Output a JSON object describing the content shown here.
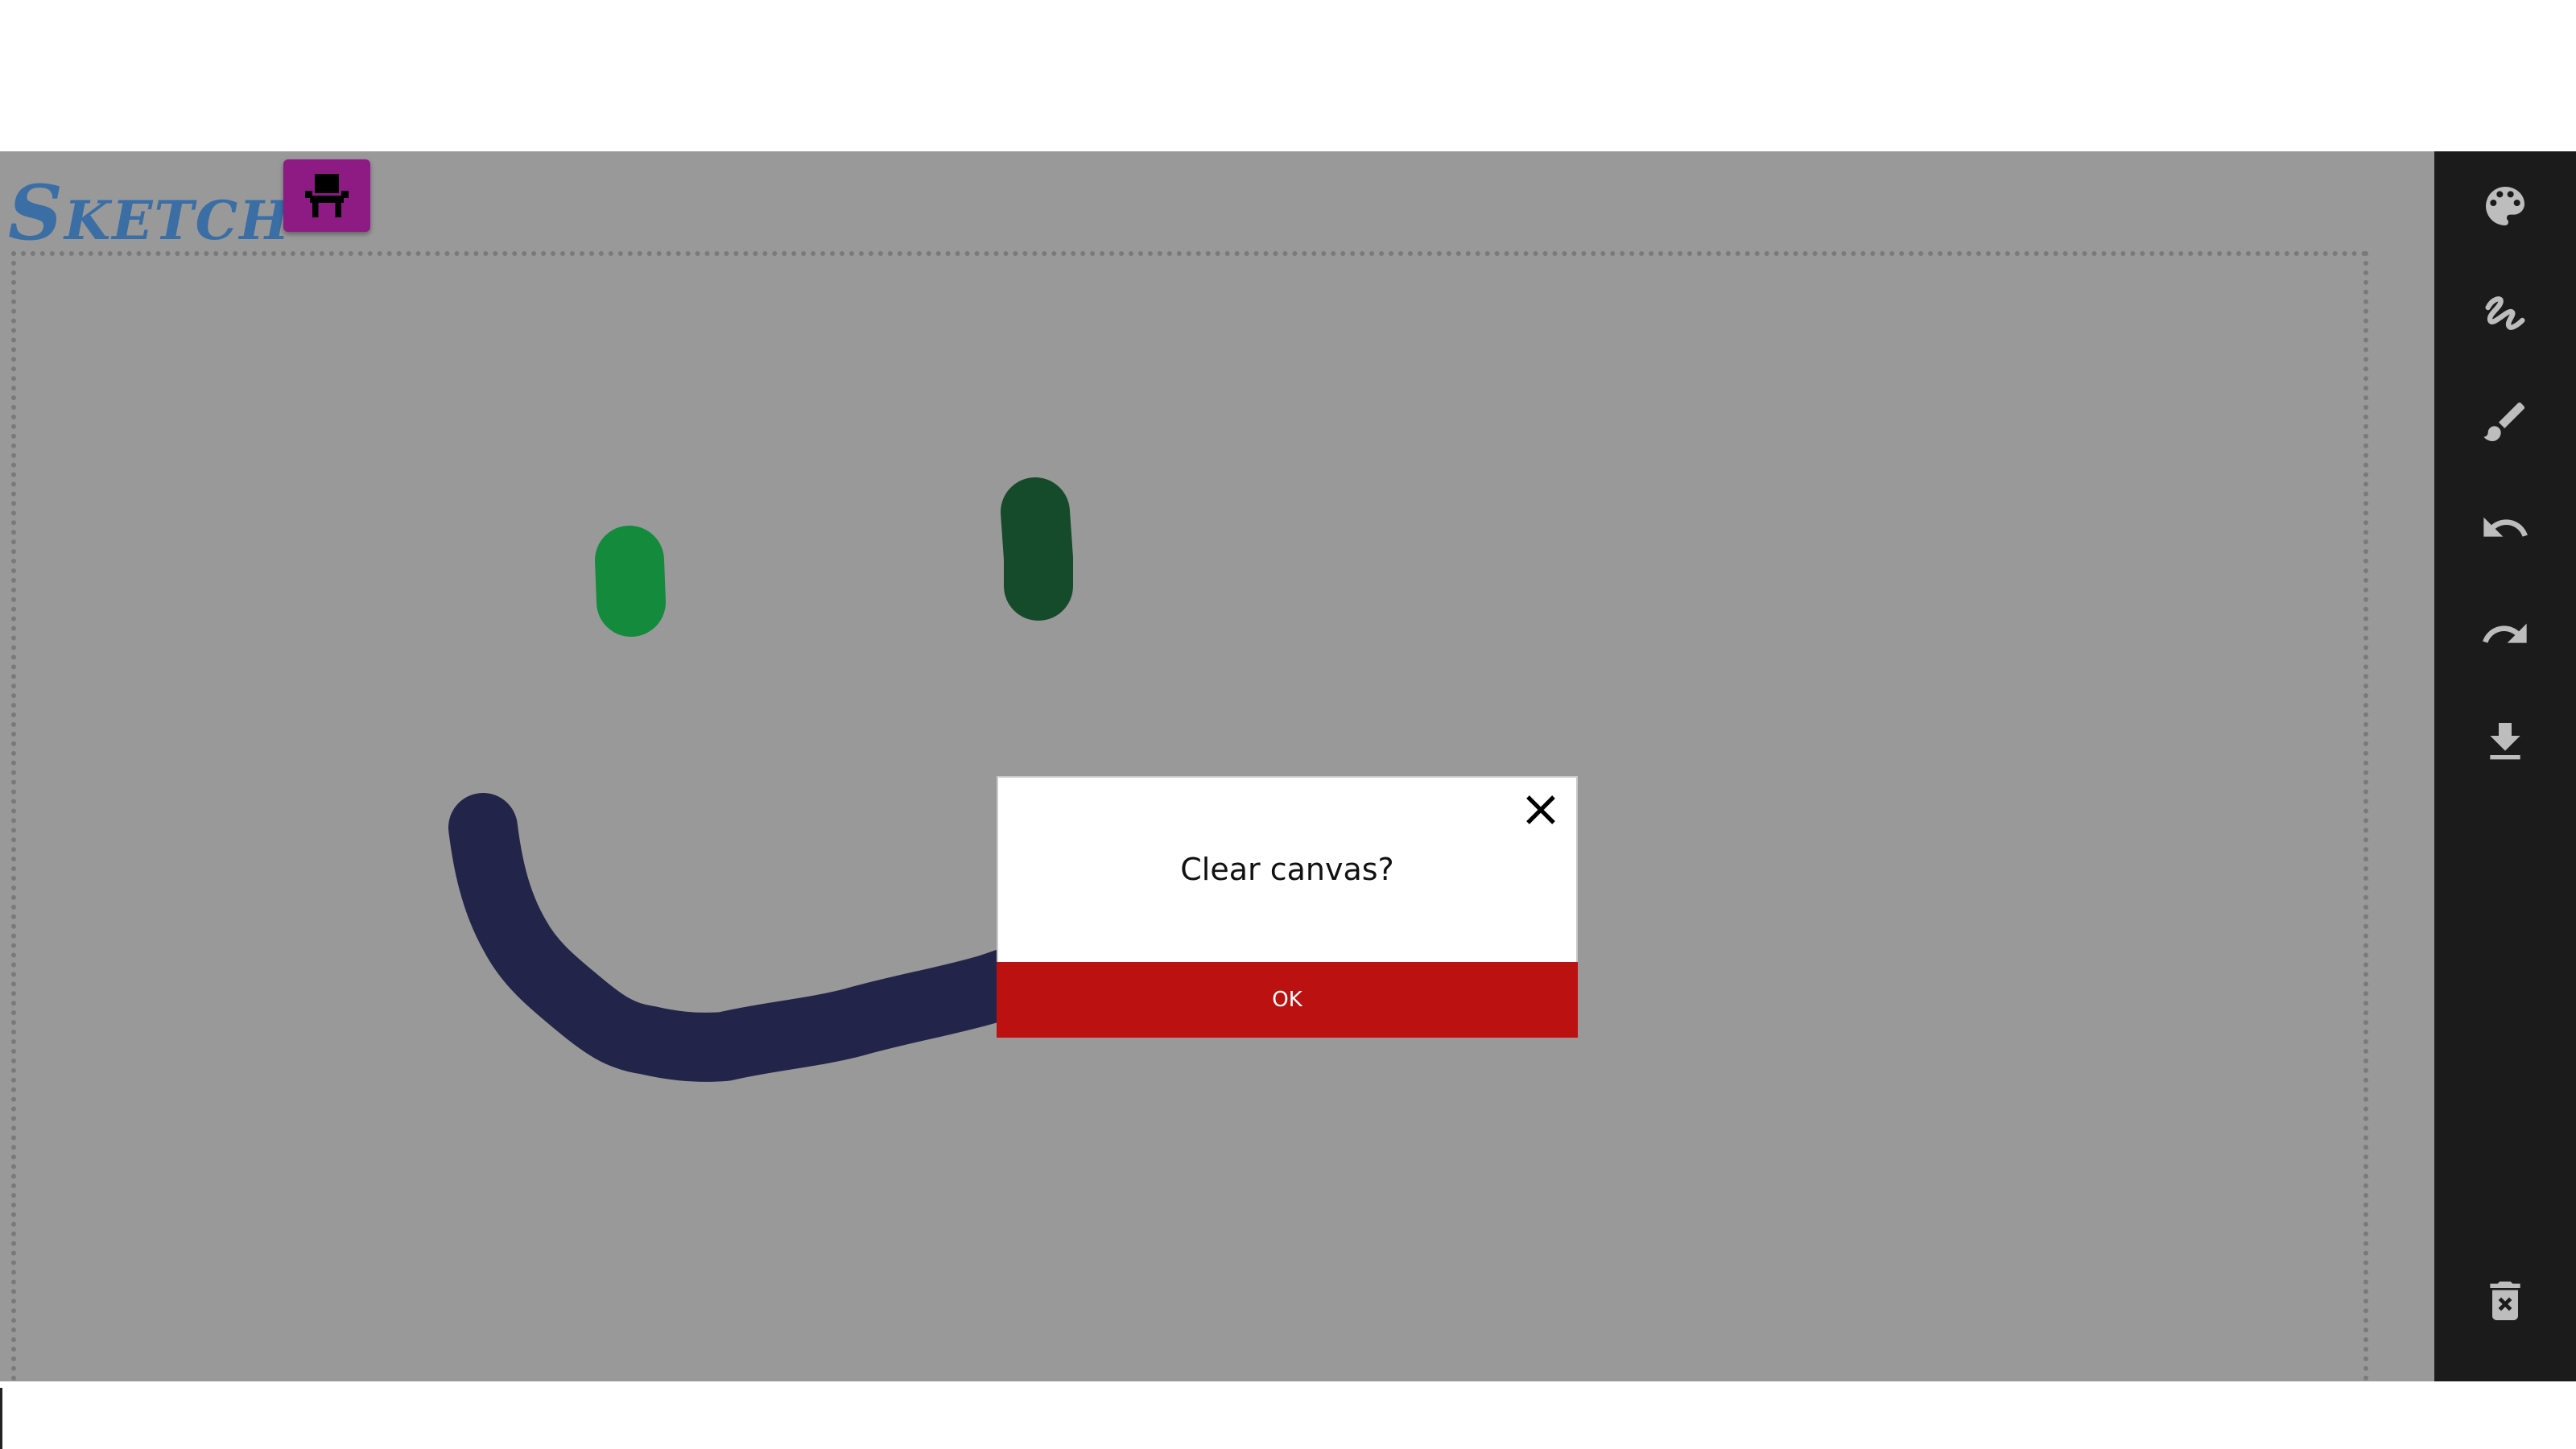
{
  "app": {
    "title": "Sketch",
    "title_color": "#3a6ea5",
    "chair_button_color": "#8e1a84",
    "chair_icon": "chair-icon"
  },
  "canvas": {
    "background": "#999999",
    "strokes": [
      {
        "name": "left-eye",
        "color": "#148a3c"
      },
      {
        "name": "right-eye",
        "color": "#154a2a"
      },
      {
        "name": "smile",
        "color": "#222549"
      }
    ]
  },
  "toolbar": {
    "background": "#1b1b1b",
    "tools": [
      {
        "name": "palette",
        "icon": "palette-icon"
      },
      {
        "name": "freehand",
        "icon": "scribble-icon"
      },
      {
        "name": "brush",
        "icon": "brush-icon"
      },
      {
        "name": "undo",
        "icon": "undo-icon"
      },
      {
        "name": "redo",
        "icon": "redo-icon"
      },
      {
        "name": "download",
        "icon": "download-icon"
      },
      {
        "name": "clear",
        "icon": "trash-icon"
      }
    ]
  },
  "dialog": {
    "message": "Clear canvas?",
    "ok_label": "OK",
    "ok_color": "#bb1111",
    "close_icon": "close-icon"
  }
}
